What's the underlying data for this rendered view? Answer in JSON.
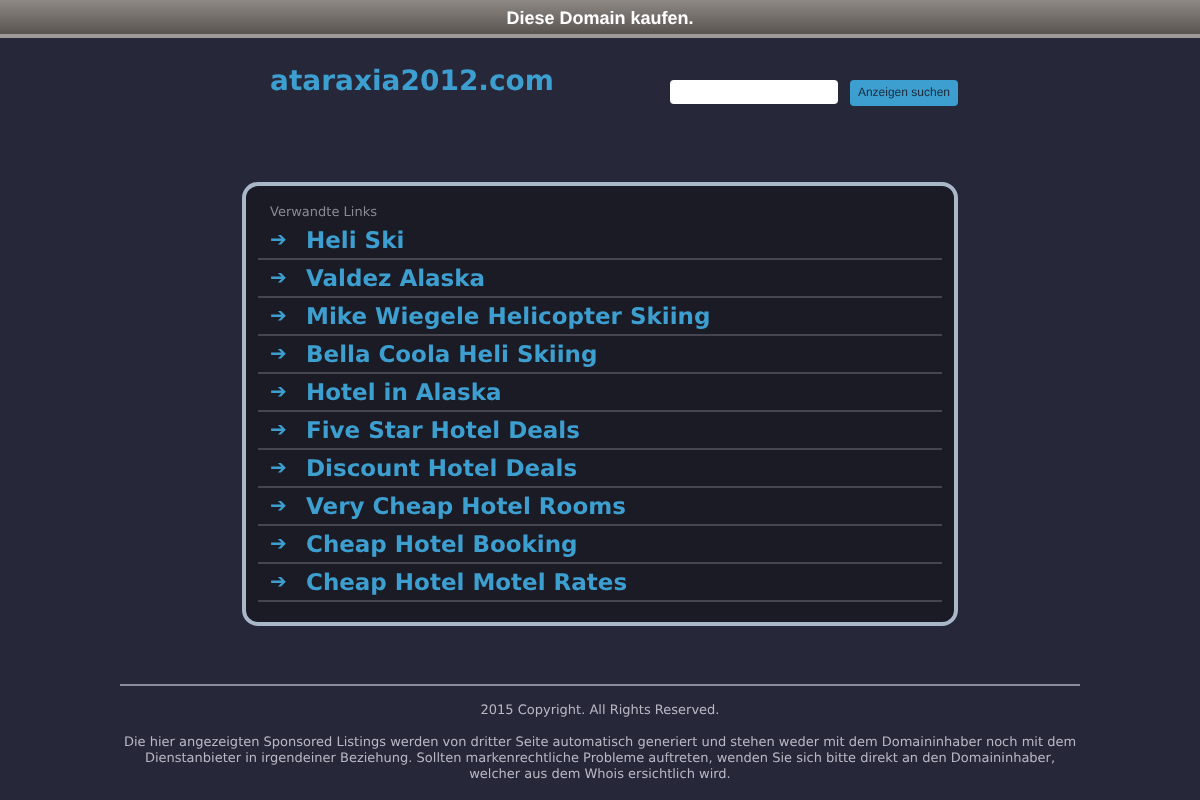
{
  "top_bar": {
    "text": "Diese Domain kaufen."
  },
  "header": {
    "domain": "ataraxia2012.com",
    "search": {
      "button": "Anzeigen suchen"
    }
  },
  "links_panel": {
    "heading": "Verwandte Links",
    "arrow": "➔",
    "links": [
      {
        "label": "Heli Ski"
      },
      {
        "label": "Valdez Alaska"
      },
      {
        "label": "Mike Wiegele Helicopter Skiing"
      },
      {
        "label": "Bella Coola Heli Skiing"
      },
      {
        "label": "Hotel in Alaska"
      },
      {
        "label": "Five Star Hotel Deals"
      },
      {
        "label": "Discount Hotel Deals"
      },
      {
        "label": "Very Cheap Hotel Rooms"
      },
      {
        "label": "Cheap Hotel Booking"
      },
      {
        "label": "Cheap Hotel Motel Rates"
      }
    ]
  },
  "footer": {
    "copyright": "2015 Copyright. All Rights Reserved.",
    "disclaimer": "Die hier angezeigten Sponsored Listings werden von dritter Seite automatisch generiert und stehen weder mit dem Domaininhaber noch mit dem Dienstanbieter in irgendeiner Beziehung. Sollten markenrechtliche Probleme auftreten, wenden Sie sich bitte direkt an den Domaininhaber, welcher aus dem Whois ersichtlich wird."
  }
}
